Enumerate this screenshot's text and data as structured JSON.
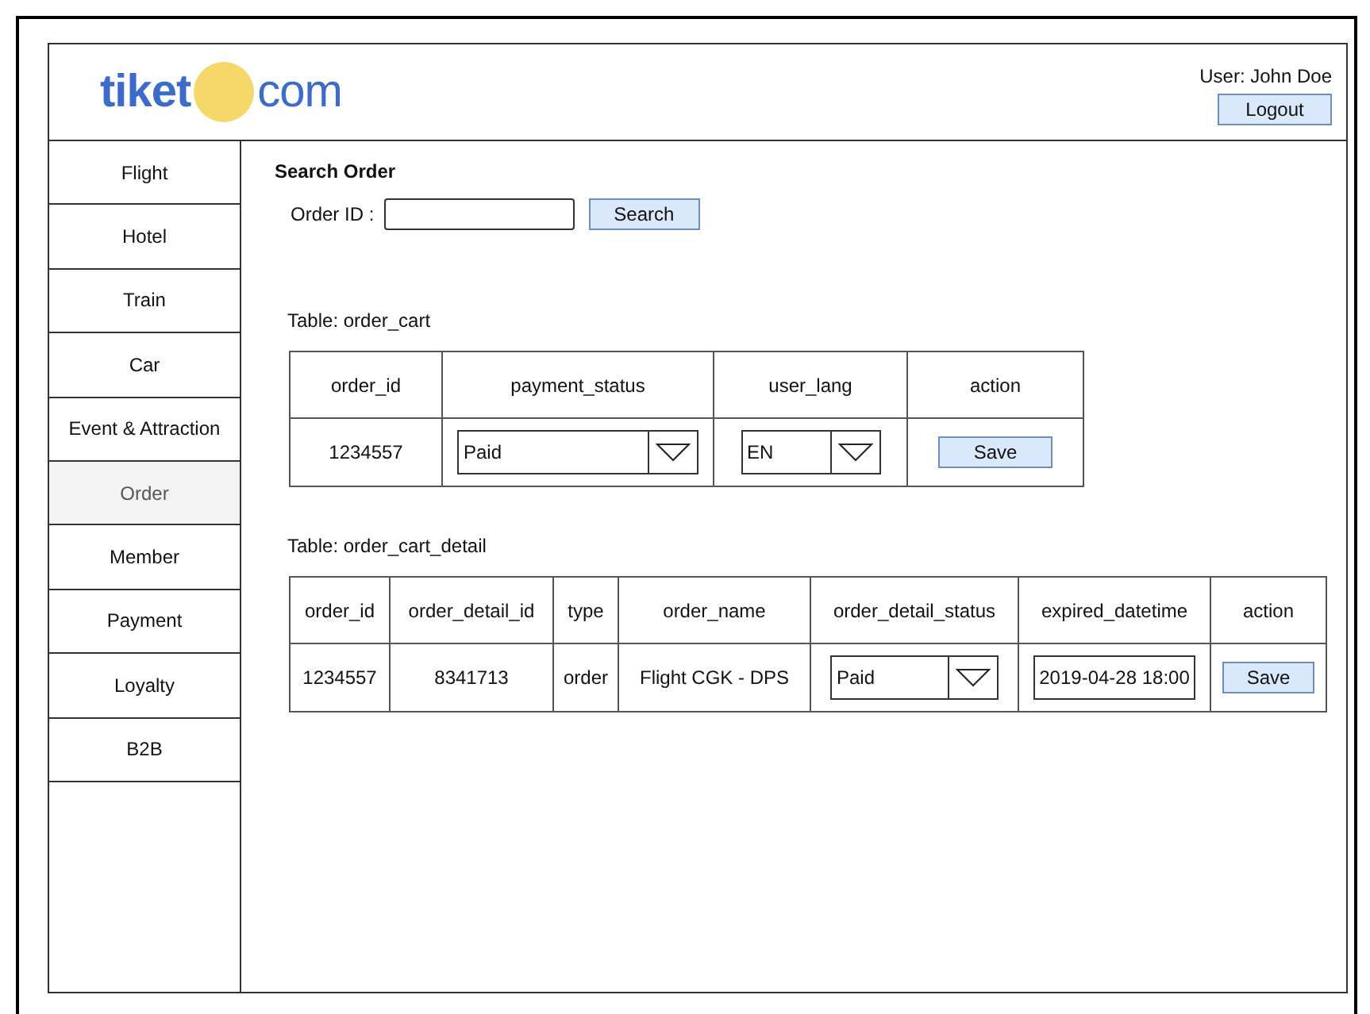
{
  "header": {
    "logo": {
      "left": "tiket",
      "right": "com"
    },
    "user": "User: John Doe",
    "logout": "Logout"
  },
  "sidebar": {
    "items": [
      {
        "label": "Flight",
        "selected": false
      },
      {
        "label": "Hotel",
        "selected": false
      },
      {
        "label": "Train",
        "selected": false
      },
      {
        "label": "Car",
        "selected": false
      },
      {
        "label": "Event & Attraction",
        "selected": false
      },
      {
        "label": "Order",
        "selected": true
      },
      {
        "label": "Member",
        "selected": false
      },
      {
        "label": "Payment",
        "selected": false
      },
      {
        "label": "Loyalty",
        "selected": false
      },
      {
        "label": "B2B",
        "selected": false
      }
    ]
  },
  "search": {
    "title": "Search Order",
    "label": "Order ID :",
    "button": "Search"
  },
  "tables": [
    {
      "caption": "Table: order_cart",
      "columns": [
        "order_id",
        "payment_status",
        "user_lang",
        "action"
      ],
      "rows": [
        [
          {
            "kind": "text",
            "text": "1234557"
          },
          {
            "kind": "select",
            "text": "Paid"
          },
          {
            "kind": "select",
            "text": "EN"
          },
          {
            "kind": "button",
            "text": "Save"
          }
        ]
      ]
    },
    {
      "caption": "Table: order_cart_detail",
      "columns": [
        "order_id",
        "order_detail_id",
        "type",
        "order_name",
        "order_detail_status",
        "expired_datetime",
        "action"
      ],
      "rows": [
        [
          {
            "kind": "text",
            "text": "1234557"
          },
          {
            "kind": "text",
            "text": "8341713"
          },
          {
            "kind": "text",
            "text": "order"
          },
          {
            "kind": "text",
            "text": "Flight CGK - DPS"
          },
          {
            "kind": "select",
            "text": "Paid"
          },
          {
            "kind": "input",
            "text": "2019-04-28 18:00"
          },
          {
            "kind": "button",
            "text": "Save"
          }
        ]
      ]
    }
  ]
}
